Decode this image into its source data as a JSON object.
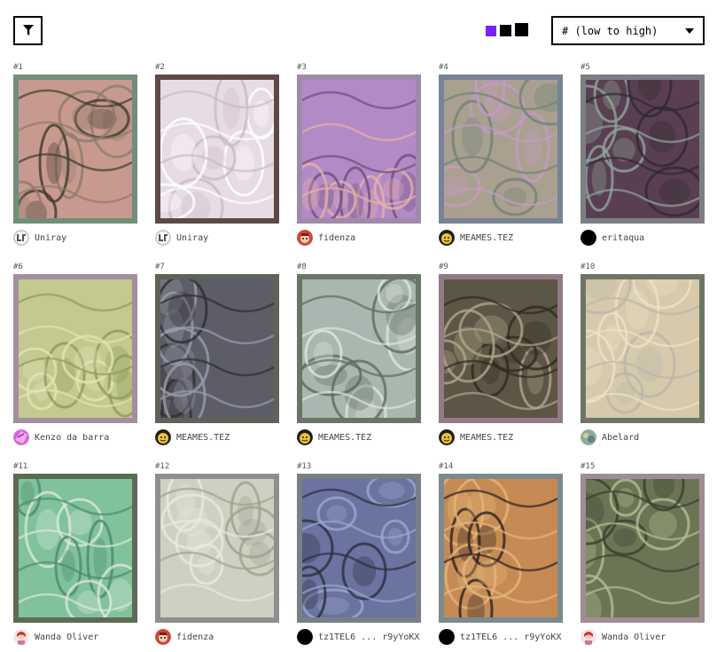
{
  "toolbar": {
    "size_colors": {
      "small": "#7b1fff",
      "medium": "#000000",
      "large": "#000000"
    },
    "sort_label": "# (low to high)"
  },
  "items": [
    {
      "num": "#1",
      "author": "Uniray",
      "avatar": "uniray",
      "frame": "#6f8f7a",
      "bg": "#c89a8f",
      "c1": "#3f3a30",
      "c2": "#8e7a6b"
    },
    {
      "num": "#2",
      "author": "Uniray",
      "avatar": "uniray",
      "frame": "#5e4a44",
      "bg": "#e6dce4",
      "c1": "#cbb9c8",
      "c2": "#ffffff"
    },
    {
      "num": "#3",
      "author": "fidenza",
      "avatar": "fidenza",
      "frame": "#a08aaa",
      "bg": "#b28ac6",
      "c1": "#6e4d7e",
      "c2": "#e7b0a4"
    },
    {
      "num": "#4",
      "author": "MEAMES.TEZ",
      "avatar": "meames",
      "frame": "#778396",
      "bg": "#a9a08f",
      "c1": "#6f8377",
      "c2": "#c69ac5"
    },
    {
      "num": "#5",
      "author": "eritaqua",
      "avatar": "black",
      "frame": "#7b7f84",
      "bg": "#5a3f52",
      "c1": "#2f2a2e",
      "c2": "#8ea59c"
    },
    {
      "num": "#6",
      "author": "Kenzo da barra",
      "avatar": "kenzo",
      "frame": "#a48ea0",
      "bg": "#c3c98f",
      "c1": "#8e9b5d",
      "c2": "#e3e3b4"
    },
    {
      "num": "#7",
      "author": "MEAMES.TEZ",
      "avatar": "meames",
      "frame": "#5d6357",
      "bg": "#5c5d66",
      "c1": "#2d2f2f",
      "c2": "#9b9bb0"
    },
    {
      "num": "#8",
      "author": "MEAMES.TEZ",
      "avatar": "meames",
      "frame": "#6a7567",
      "bg": "#a9b7b0",
      "c1": "#5d6a61",
      "c2": "#dfe5e0"
    },
    {
      "num": "#9",
      "author": "MEAMES.TEZ",
      "avatar": "meames",
      "frame": "#937a86",
      "bg": "#5c5646",
      "c1": "#2d2a22",
      "c2": "#b2a58a"
    },
    {
      "num": "#10",
      "author": "Abelard",
      "avatar": "abelard",
      "frame": "#6e7565",
      "bg": "#d6c9ac",
      "c1": "#b9b6a9",
      "c2": "#ede2c6"
    },
    {
      "num": "#11",
      "author": "Wanda Oliver",
      "avatar": "wanda",
      "frame": "#5e6a54",
      "bg": "#7fc29b",
      "c1": "#4e8a6a",
      "c2": "#d9e7d9"
    },
    {
      "num": "#12",
      "author": "fidenza",
      "avatar": "fidenza",
      "frame": "#8f8f8f",
      "bg": "#cfd0c2",
      "c1": "#9fa18e",
      "c2": "#e8e8de"
    },
    {
      "num": "#13",
      "author": "tz1TEL6 ... r9yYoKX",
      "avatar": "black",
      "frame": "#7a7f85",
      "bg": "#6b73a0",
      "c1": "#2c2e3e",
      "c2": "#9aa7cf"
    },
    {
      "num": "#14",
      "author": "tz1TEL6 ... r9yYoKX",
      "avatar": "black",
      "frame": "#7b8a8f",
      "bg": "#c68a55",
      "c1": "#2b2220",
      "c2": "#e3b777"
    },
    {
      "num": "#15",
      "author": "Wanda Oliver",
      "avatar": "wanda",
      "frame": "#a08c94",
      "bg": "#6b7556",
      "c1": "#3b3f2f",
      "c2": "#b5bd92"
    }
  ]
}
